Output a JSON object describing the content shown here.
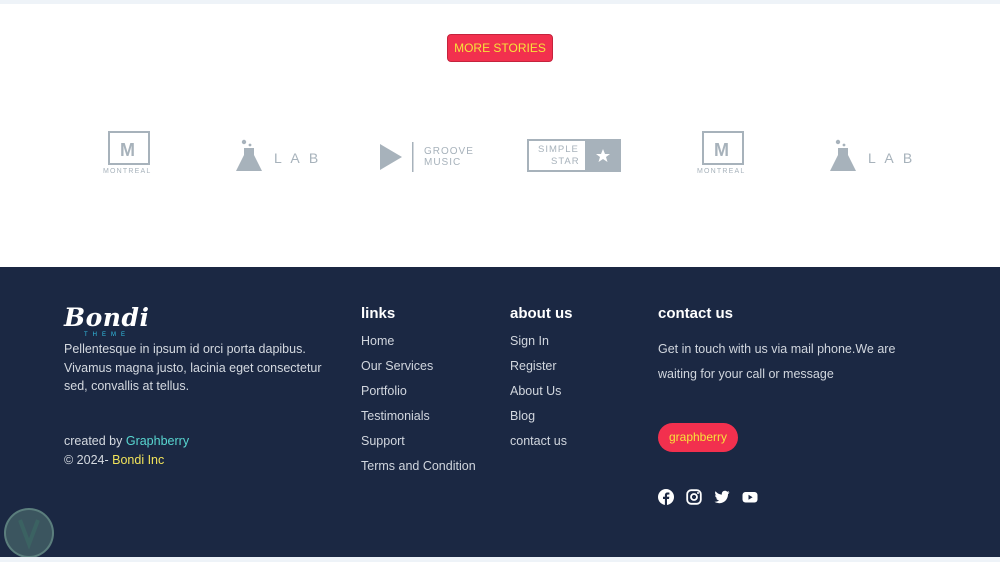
{
  "more_stories": {
    "label": "MORE STORIES"
  },
  "logos": {
    "montreal_1": {
      "letter": "M",
      "name": "MONTREAL"
    },
    "lab_1": {
      "name": "L A B"
    },
    "groove": {
      "line1": "GROOVE",
      "line2": "MUSIC"
    },
    "simple_star": {
      "line1": "SIMPLE",
      "line2": "STAR"
    },
    "montreal_2": {
      "letter": "M",
      "name": "MONTREAL"
    },
    "lab_2": {
      "name": "L A B"
    }
  },
  "footer": {
    "brand": {
      "name": "Bondi",
      "subtitle": "THEME"
    },
    "about_text": "Pellentesque in ipsum id orci porta dapibus. Vivamus magna justo, lacinia eget consectetur sed, convallis at tellus.",
    "created_prefix": "created by ",
    "created_link": "Graphberry",
    "copyright_prefix": "© 2024- ",
    "copyright_link": "Bondi Inc",
    "links": {
      "title": "links",
      "items": [
        "Home",
        "Our Services",
        "Portfolio",
        "Testimonials",
        "Support",
        "Terms and Condition"
      ]
    },
    "about_us": {
      "title": "about us",
      "items": [
        "Sign In",
        "Register",
        "About Us",
        "Blog",
        "contact us"
      ]
    },
    "contact": {
      "title": "contact us",
      "text": "Get in touch with us via mail phone.We are waiting for your call or message",
      "button_label": "graphberry",
      "social_icons": [
        "facebook-icon",
        "instagram-icon",
        "twitter-icon",
        "youtube-icon"
      ]
    }
  },
  "colors": {
    "accent_red": "#f2304e",
    "accent_yellow": "#f6e33b",
    "footer_bg": "#1b2843",
    "logo_gray": "#a7b2bb"
  }
}
